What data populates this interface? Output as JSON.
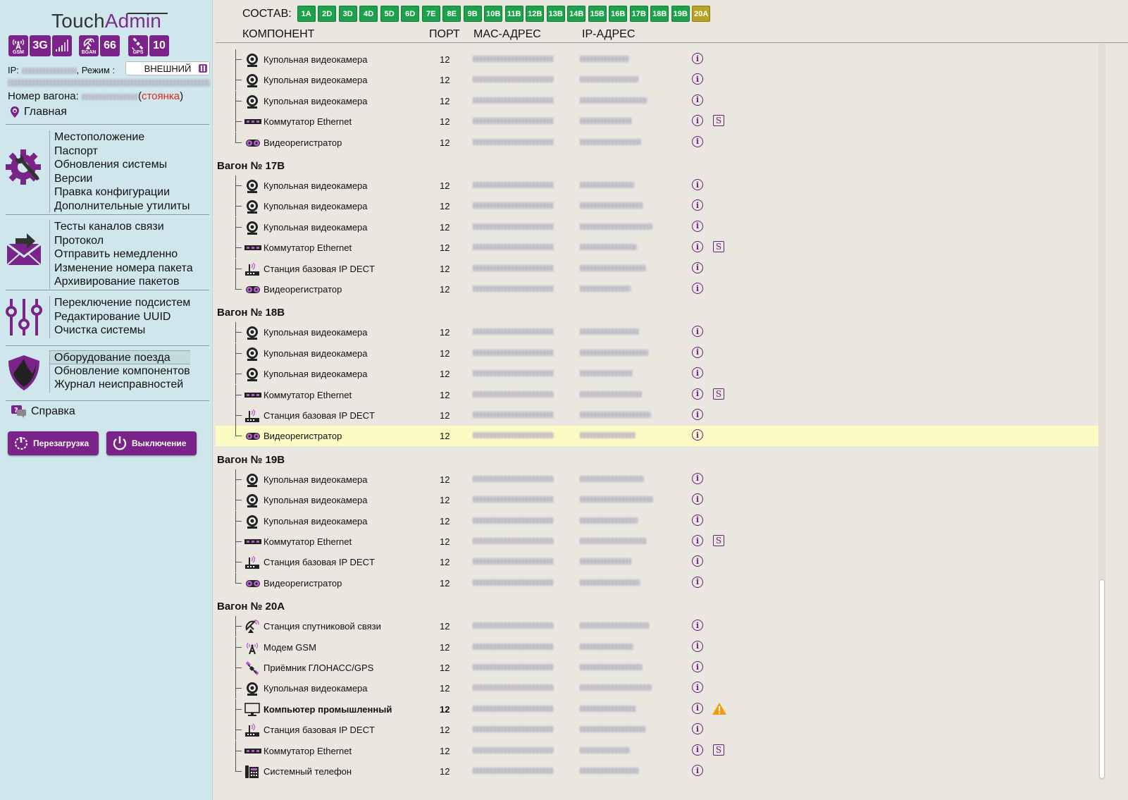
{
  "app": {
    "logo_part1": "Touch",
    "logo_part2": "Admin"
  },
  "signal": {
    "gsm_label": "GSM",
    "gsm_type": "3G",
    "bgan_label": "BGAN",
    "bgan_value": "66",
    "gps_label": "GPS",
    "gps_value": "10"
  },
  "status": {
    "ip_label": "IP:",
    "mode_label": ", Режим :",
    "mode_value": "ВНЕШНИЙ",
    "vagon_label": "Номер вагона:",
    "state_open": "(",
    "state_value": "стоянка",
    "state_close": ")"
  },
  "nav": {
    "home": "Главная",
    "help": "Справка",
    "group1": [
      "Местоположение",
      "Паспорт",
      "Обновления системы",
      "Версии",
      "Правка конфигурации",
      "Дополнительные утилиты"
    ],
    "group2": [
      "Тесты каналов связи",
      "Протокол",
      "Отправить немедленно",
      "Изменение номера пакета",
      "Архивирование пакетов"
    ],
    "group3": [
      "Переключение подсистем",
      "Редактирование UUID",
      "Очистка системы"
    ],
    "group4": [
      "Оборудование поезда",
      "Обновление компонентов",
      "Журнал неисправностей"
    ]
  },
  "buttons": {
    "reboot": "Перезагрузка",
    "shutdown": "Выключение"
  },
  "sostav": {
    "label": "СОСТАВ:",
    "cars": [
      "1A",
      "2D",
      "3D",
      "4D",
      "5D",
      "6D",
      "7E",
      "8E",
      "9B",
      "10B",
      "11B",
      "12B",
      "13B",
      "14B",
      "15B",
      "16B",
      "17B",
      "18B",
      "19B",
      "20A"
    ],
    "current": "20A"
  },
  "table": {
    "col_component": "КОМПОНЕНТ",
    "col_port": "ПОРТ",
    "col_mac": "MAC-АДРЕС",
    "col_ip": "IP-АДРЕС"
  },
  "colors": {
    "accent": "#7a2489",
    "car_ok": "#1ea14d",
    "car_current": "#b8a225",
    "highlight_row": "#fdfbc4",
    "warning": "#f39c12"
  },
  "groups": [
    {
      "title": "",
      "rows": [
        {
          "icon": "dome-camera-icon",
          "name": "Купольная видеокамера",
          "port": "12",
          "s": false
        },
        {
          "icon": "dome-camera-icon",
          "name": "Купольная видеокамера",
          "port": "12",
          "s": false
        },
        {
          "icon": "dome-camera-icon",
          "name": "Купольная видеокамера",
          "port": "12",
          "s": false
        },
        {
          "icon": "ethernet-switch-icon",
          "name": "Коммутатор Ethernet",
          "port": "12",
          "s": true
        },
        {
          "icon": "video-recorder-icon",
          "name": "Видеорегистратор",
          "port": "12",
          "s": false
        }
      ]
    },
    {
      "title": "Вагон № 17B",
      "rows": [
        {
          "icon": "dome-camera-icon",
          "name": "Купольная видеокамера",
          "port": "12",
          "s": false
        },
        {
          "icon": "dome-camera-icon",
          "name": "Купольная видеокамера",
          "port": "12",
          "s": false
        },
        {
          "icon": "dome-camera-icon",
          "name": "Купольная видеокамера",
          "port": "12",
          "s": false
        },
        {
          "icon": "ethernet-switch-icon",
          "name": "Коммутатор Ethernet",
          "port": "12",
          "s": true
        },
        {
          "icon": "dect-station-icon",
          "name": "Станция базовая IP DECT",
          "port": "12",
          "s": false
        },
        {
          "icon": "video-recorder-icon",
          "name": "Видеорегистратор",
          "port": "12",
          "s": false
        }
      ]
    },
    {
      "title": "Вагон № 18B",
      "rows": [
        {
          "icon": "dome-camera-icon",
          "name": "Купольная видеокамера",
          "port": "12",
          "s": false
        },
        {
          "icon": "dome-camera-icon",
          "name": "Купольная видеокамера",
          "port": "12",
          "s": false
        },
        {
          "icon": "dome-camera-icon",
          "name": "Купольная видеокамера",
          "port": "12",
          "s": false
        },
        {
          "icon": "ethernet-switch-icon",
          "name": "Коммутатор Ethernet",
          "port": "12",
          "s": true
        },
        {
          "icon": "dect-station-icon",
          "name": "Станция базовая IP DECT",
          "port": "12",
          "s": false
        },
        {
          "icon": "video-recorder-icon",
          "name": "Видеорегистратор",
          "port": "12",
          "s": false,
          "highlight": true
        }
      ]
    },
    {
      "title": "Вагон № 19B",
      "rows": [
        {
          "icon": "dome-camera-icon",
          "name": "Купольная видеокамера",
          "port": "12",
          "s": false
        },
        {
          "icon": "dome-camera-icon",
          "name": "Купольная видеокамера",
          "port": "12",
          "s": false
        },
        {
          "icon": "dome-camera-icon",
          "name": "Купольная видеокамера",
          "port": "12",
          "s": false
        },
        {
          "icon": "ethernet-switch-icon",
          "name": "Коммутатор Ethernet",
          "port": "12",
          "s": true
        },
        {
          "icon": "dect-station-icon",
          "name": "Станция базовая IP DECT",
          "port": "12",
          "s": false
        },
        {
          "icon": "video-recorder-icon",
          "name": "Видеорегистратор",
          "port": "12",
          "s": false
        }
      ]
    },
    {
      "title": "Вагон № 20A",
      "rows": [
        {
          "icon": "satellite-station-icon",
          "name": "Станция спутниковой связи",
          "port": "12",
          "s": false
        },
        {
          "icon": "gsm-modem-icon",
          "name": "Модем GSM",
          "port": "12",
          "s": false
        },
        {
          "icon": "gps-receiver-icon",
          "name": "Приёмник ГЛОНАСС/GPS",
          "port": "12",
          "s": false
        },
        {
          "icon": "dome-camera-icon",
          "name": "Купольная видеокамера",
          "port": "12",
          "s": false
        },
        {
          "icon": "industrial-computer-icon",
          "name": "Компьютер промышленный",
          "port": "12",
          "s": false,
          "bold": true,
          "warning": true
        },
        {
          "icon": "dect-station-icon",
          "name": "Станция базовая IP DECT",
          "port": "12",
          "s": false
        },
        {
          "icon": "ethernet-switch-icon",
          "name": "Коммутатор Ethernet",
          "port": "12",
          "s": true
        },
        {
          "icon": "system-phone-icon",
          "name": "Системный телефон",
          "port": "12",
          "s": false
        }
      ]
    }
  ],
  "info_glyph": "i",
  "s_glyph": "S"
}
